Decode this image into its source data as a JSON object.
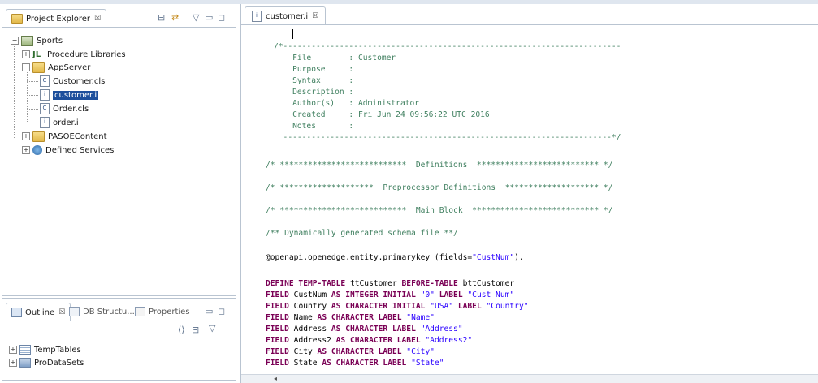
{
  "project_explorer": {
    "tab_label": "Project Explorer",
    "close_glyph": "☒",
    "tree": [
      {
        "label": "Sports",
        "icon": "project-icon"
      },
      {
        "label": "Procedure Libraries",
        "icon": "library-icon"
      },
      {
        "label": "AppServer",
        "icon": "folder-icon"
      },
      {
        "label": "Customer.cls",
        "icon": "class-file-icon"
      },
      {
        "label": "customer.i",
        "icon": "include-file-icon",
        "selected": true
      },
      {
        "label": "Order.cls",
        "icon": "class-file-icon"
      },
      {
        "label": "order.i",
        "icon": "include-file-icon"
      },
      {
        "label": "PASOEContent",
        "icon": "folder-icon"
      },
      {
        "label": "Defined Services",
        "icon": "services-icon"
      }
    ]
  },
  "bottom_panel": {
    "tabs": [
      {
        "label": "Outline",
        "close": "☒"
      },
      {
        "label": "DB Structu..."
      },
      {
        "label": "Properties"
      }
    ],
    "tree": [
      {
        "label": "TempTables"
      },
      {
        "label": "ProDataSets"
      }
    ]
  },
  "editor": {
    "tab_label": "customer.i",
    "close_glyph": "☒",
    "lines": [
      [
        {
          "t": "/*------------------------------------------------------------------------",
          "c": "cmt"
        }
      ],
      [
        {
          "t": "    File        : Customer",
          "c": "cmt"
        }
      ],
      [
        {
          "t": "    Purpose     :",
          "c": "cmt"
        }
      ],
      [
        {
          "t": "    Syntax      :",
          "c": "cmt"
        }
      ],
      [
        {
          "t": "    Description :",
          "c": "cmt"
        }
      ],
      [
        {
          "t": "    Author(s)   : Administrator",
          "c": "cmt"
        }
      ],
      [
        {
          "t": "    Created     : Fri Jun 24 09:56:22 UTC 2016",
          "c": "cmt"
        }
      ],
      [
        {
          "t": "    Notes       :",
          "c": "cmt"
        }
      ],
      [
        {
          "t": "  ----------------------------------------------------------------------*/",
          "c": "cmt"
        }
      ],
      [
        {
          "t": "",
          "c": "plain"
        }
      ],
      [
        {
          "t": "/* ***************************  Definitions  ************************** */",
          "c": "cmt"
        }
      ],
      [
        {
          "t": "",
          "c": "plain"
        }
      ],
      [
        {
          "t": "/* ********************  Preprocessor Definitions  ******************** */",
          "c": "cmt"
        }
      ],
      [
        {
          "t": "",
          "c": "plain"
        }
      ],
      [
        {
          "t": "/* ***************************  Main Block  *************************** */",
          "c": "cmt"
        }
      ],
      [
        {
          "t": "",
          "c": "plain"
        }
      ],
      [
        {
          "t": "/** Dynamically generated schema file **/",
          "c": "cmt"
        }
      ],
      [
        {
          "t": "",
          "c": "plain"
        }
      ],
      [
        {
          "t": "@openapi.openedge.entity.primarykey (fields=",
          "c": "plain"
        },
        {
          "t": "\"CustNum\"",
          "c": "str"
        },
        {
          "t": ").",
          "c": "plain"
        }
      ],
      [
        {
          "t": "",
          "c": "plain"
        }
      ],
      [
        {
          "t": "DEFINE TEMP-TABLE",
          "c": "kw"
        },
        {
          "t": " ttCustomer ",
          "c": "plain"
        },
        {
          "t": "BEFORE-TABLE",
          "c": "kw"
        },
        {
          "t": " bttCustomer",
          "c": "plain"
        }
      ],
      [
        {
          "t": "FIELD",
          "c": "kw"
        },
        {
          "t": " CustNum ",
          "c": "plain"
        },
        {
          "t": "AS INTEGER INITIAL",
          "c": "kw"
        },
        {
          "t": " ",
          "c": "plain"
        },
        {
          "t": "\"0\"",
          "c": "str"
        },
        {
          "t": " ",
          "c": "plain"
        },
        {
          "t": "LABEL",
          "c": "kw"
        },
        {
          "t": " ",
          "c": "plain"
        },
        {
          "t": "\"Cust Num\"",
          "c": "str"
        }
      ],
      [
        {
          "t": "FIELD",
          "c": "kw"
        },
        {
          "t": " Country ",
          "c": "plain"
        },
        {
          "t": "AS CHARACTER INITIAL",
          "c": "kw"
        },
        {
          "t": " ",
          "c": "plain"
        },
        {
          "t": "\"USA\"",
          "c": "str"
        },
        {
          "t": " ",
          "c": "plain"
        },
        {
          "t": "LABEL",
          "c": "kw"
        },
        {
          "t": " ",
          "c": "plain"
        },
        {
          "t": "\"Country\"",
          "c": "str"
        }
      ],
      [
        {
          "t": "FIELD",
          "c": "kw"
        },
        {
          "t": " Name ",
          "c": "plain"
        },
        {
          "t": "AS CHARACTER LABEL",
          "c": "kw"
        },
        {
          "t": " ",
          "c": "plain"
        },
        {
          "t": "\"Name\"",
          "c": "str"
        }
      ],
      [
        {
          "t": "FIELD",
          "c": "kw"
        },
        {
          "t": " Address ",
          "c": "plain"
        },
        {
          "t": "AS CHARACTER LABEL",
          "c": "kw"
        },
        {
          "t": " ",
          "c": "plain"
        },
        {
          "t": "\"Address\"",
          "c": "str"
        }
      ],
      [
        {
          "t": "FIELD",
          "c": "kw"
        },
        {
          "t": " Address2 ",
          "c": "plain"
        },
        {
          "t": "AS CHARACTER LABEL",
          "c": "kw"
        },
        {
          "t": " ",
          "c": "plain"
        },
        {
          "t": "\"Address2\"",
          "c": "str"
        }
      ],
      [
        {
          "t": "FIELD",
          "c": "kw"
        },
        {
          "t": " City ",
          "c": "plain"
        },
        {
          "t": "AS CHARACTER LABEL",
          "c": "kw"
        },
        {
          "t": " ",
          "c": "plain"
        },
        {
          "t": "\"City\"",
          "c": "str"
        }
      ],
      [
        {
          "t": "FIELD",
          "c": "kw"
        },
        {
          "t": " State ",
          "c": "plain"
        },
        {
          "t": "AS CHARACTER LABEL",
          "c": "kw"
        },
        {
          "t": " ",
          "c": "plain"
        },
        {
          "t": "\"State\"",
          "c": "str"
        }
      ]
    ]
  },
  "colors": {
    "comment": "#3f7f5f",
    "keyword": "#7a0055",
    "string": "#2a00ff",
    "selection": "#1d4f9c"
  }
}
